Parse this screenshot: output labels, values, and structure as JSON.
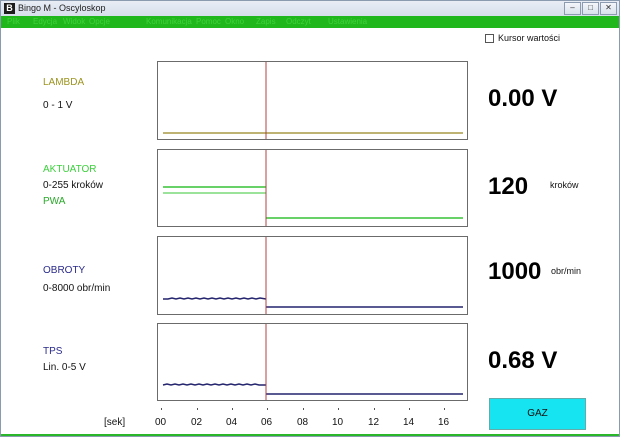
{
  "window": {
    "title": "Bingo M - Oscyloskop",
    "app_icon": "B",
    "controls": [
      "minimize-icon",
      "maximize-icon",
      "close-icon"
    ]
  },
  "menu": {
    "items": [
      "Plik",
      "Edycja",
      "Widok",
      "Opcje",
      "Komunikacja",
      "Pomoc",
      "Okno",
      "Zapis",
      "Odczyt",
      "Ustawienia"
    ],
    "bar_color": "#1fb71b",
    "text_color": "#3fd23b"
  },
  "kursor": {
    "label": "Kursor wartości",
    "checked": false
  },
  "channels": [
    {
      "name": "LAMBDA",
      "name_color": "#9c9420",
      "range": "0 - 1 V",
      "value": "0.00 V",
      "unit": "",
      "trace_color": "#a89a44"
    },
    {
      "name": "AKTUATOR",
      "name_color": "#3cd03c",
      "range": "0-255 kroków",
      "sub_name": "PWA",
      "sub_color": "#2aa92a",
      "value": "120",
      "unit": "kroków",
      "trace_color": "#37c437"
    },
    {
      "name": "OBROTY",
      "name_color": "#2a2a8a",
      "range": "0-8000 obr/min",
      "value": "1000",
      "unit": "obr/min",
      "trace_color": "#24246e"
    },
    {
      "name": "TPS",
      "name_color": "#2a2a8a",
      "range": "Lin. 0-5 V",
      "value": "0.68 V",
      "unit": "",
      "trace_color": "#24246e"
    }
  ],
  "axis": {
    "unit_label": "[sek]",
    "ticks": [
      "00",
      "02",
      "04",
      "06",
      "08",
      "10",
      "12",
      "14",
      "16"
    ]
  },
  "cursor_line_color": "#b04040",
  "gaz_button": {
    "label": "GAZ",
    "color": "#16e4f0"
  }
}
